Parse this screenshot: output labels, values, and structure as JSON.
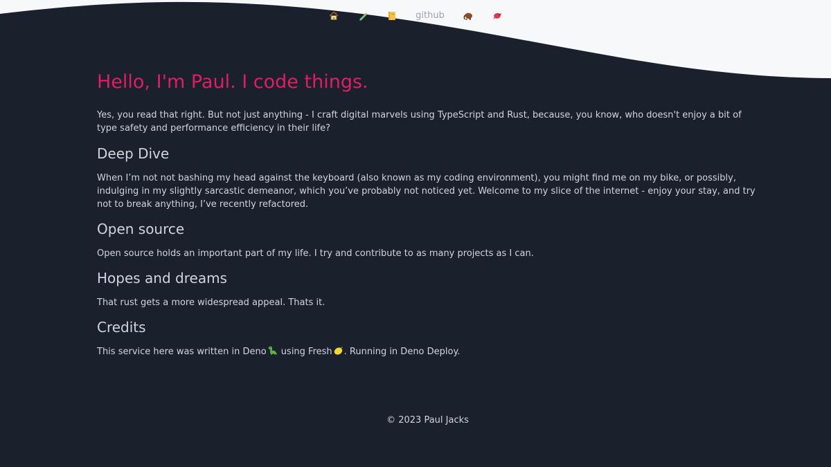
{
  "colors": {
    "background": "#1a202c",
    "wave": "#f7f8fa",
    "accent": "#e11d63",
    "text": "#d1d5db",
    "nav_text": "#9ca3af"
  },
  "nav": {
    "items": [
      {
        "name": "home",
        "icon": "house-icon"
      },
      {
        "name": "pen",
        "icon": "pen-icon"
      },
      {
        "name": "notebook",
        "icon": "notebook-icon"
      },
      {
        "name": "github",
        "label": "github"
      },
      {
        "name": "mastodon",
        "icon": "mammoth-icon"
      },
      {
        "name": "bird",
        "icon": "bird-icon"
      }
    ]
  },
  "main": {
    "title": "Hello, I'm Paul. I code things.",
    "intro": "Yes, you read that right. But not just anything - I craft digital marvels using TypeScript and Rust, because, you know, who doesn't enjoy a bit of type safety and performance efficiency in their life?",
    "sections": [
      {
        "heading": "Deep Dive",
        "text": "When I’m not not bashing my head against the keyboard (also known as my coding environment), you might find me on my bike, or possibly, indulging in my slightly sarcastic demeanor, which you’ve probably not noticed yet. Welcome to my slice of the internet - enjoy your stay, and try not to break anything, I’ve recently refactored."
      },
      {
        "heading": "Open source",
        "text": "Open source holds an important part of my life. I try and contribute to  as many projects as I can."
      },
      {
        "heading": "Hopes and dreams",
        "text": "That rust gets a more widespread appeal. Thats it."
      },
      {
        "heading": "Credits",
        "text_part1": "This service here was written in Deno",
        "text_part2": " using Fresh",
        "text_part3": ". Running in Deno Deploy.",
        "icons": [
          "dinosaur-icon",
          "lemon-icon"
        ]
      }
    ]
  },
  "footer": {
    "text": "© 2023 Paul Jacks"
  }
}
